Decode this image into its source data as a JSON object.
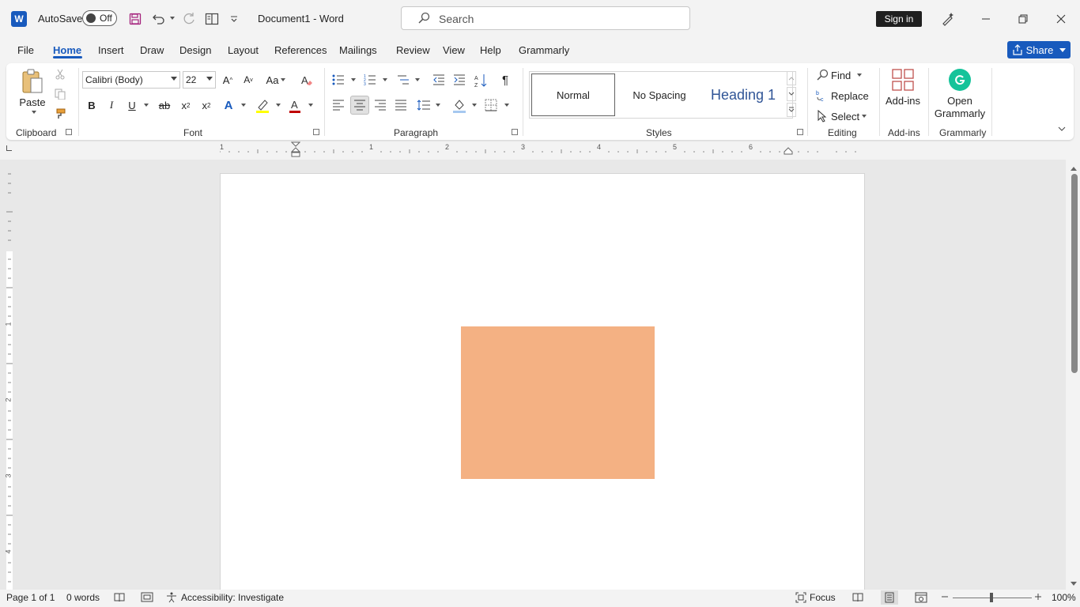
{
  "titlebar": {
    "autosave_label": "AutoSave",
    "autosave_state": "Off",
    "doc_title": "Document1  -  Word",
    "search_placeholder": "Search",
    "signin_label": "Sign in"
  },
  "tabs": [
    "File",
    "Home",
    "Insert",
    "Draw",
    "Design",
    "Layout",
    "References",
    "Mailings",
    "Review",
    "View",
    "Help",
    "Grammarly"
  ],
  "share_label": "Share",
  "ribbon": {
    "clipboard": {
      "label": "Clipboard",
      "paste": "Paste"
    },
    "font": {
      "label": "Font",
      "font_name": "Calibri (Body)",
      "font_size": "22",
      "change_case": "Aa"
    },
    "paragraph": {
      "label": "Paragraph"
    },
    "styles": {
      "label": "Styles",
      "items": [
        "Normal",
        "No Spacing",
        "Heading 1"
      ]
    },
    "editing": {
      "label": "Editing",
      "find": "Find",
      "replace": "Replace",
      "select": "Select"
    },
    "addins": {
      "label": "Add-ins",
      "button": "Add-ins"
    },
    "grammarly": {
      "label": "Grammarly",
      "button_line1": "Open",
      "button_line2": "Grammarly"
    }
  },
  "ruler_numbers": [
    "1",
    "1",
    "2",
    "3",
    "4",
    "5",
    "6"
  ],
  "vruler_numbers": [
    "1",
    "2",
    "3",
    "4"
  ],
  "shape": {
    "fill": "#f4b183"
  },
  "status": {
    "page": "Page 1 of 1",
    "words": "0 words",
    "accessibility": "Accessibility: Investigate",
    "focus": "Focus",
    "zoom": "100%"
  },
  "colors": {
    "accent": "#185abd",
    "highlight": "#ffff00",
    "font_color": "#c00000"
  }
}
